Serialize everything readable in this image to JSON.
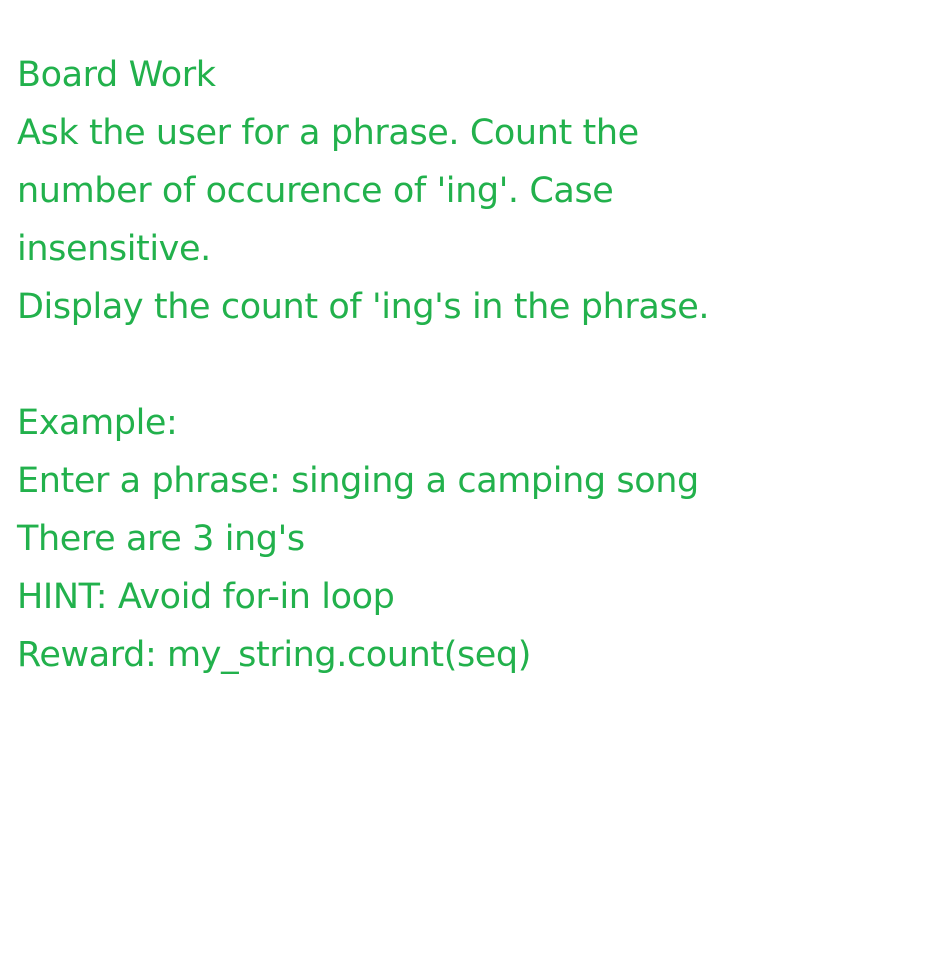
{
  "colors": {
    "text": "#22b14c",
    "background": "#ffffff"
  },
  "document": {
    "title": "Board Work",
    "task_line_1": "Ask the user for a phrase. Count the",
    "task_line_2": "number of occurence of 'ing'. Case",
    "task_line_3": "insensitive.",
    "task_line_4": "Display the count of 'ing's in the phrase.",
    "example_heading": "Example:",
    "example_input": "Enter a phrase: singing a camping song",
    "example_output": "There are 3 ing's",
    "hint": "HINT: Avoid for-in loop",
    "reward": "Reward: my_string.count(seq)"
  }
}
